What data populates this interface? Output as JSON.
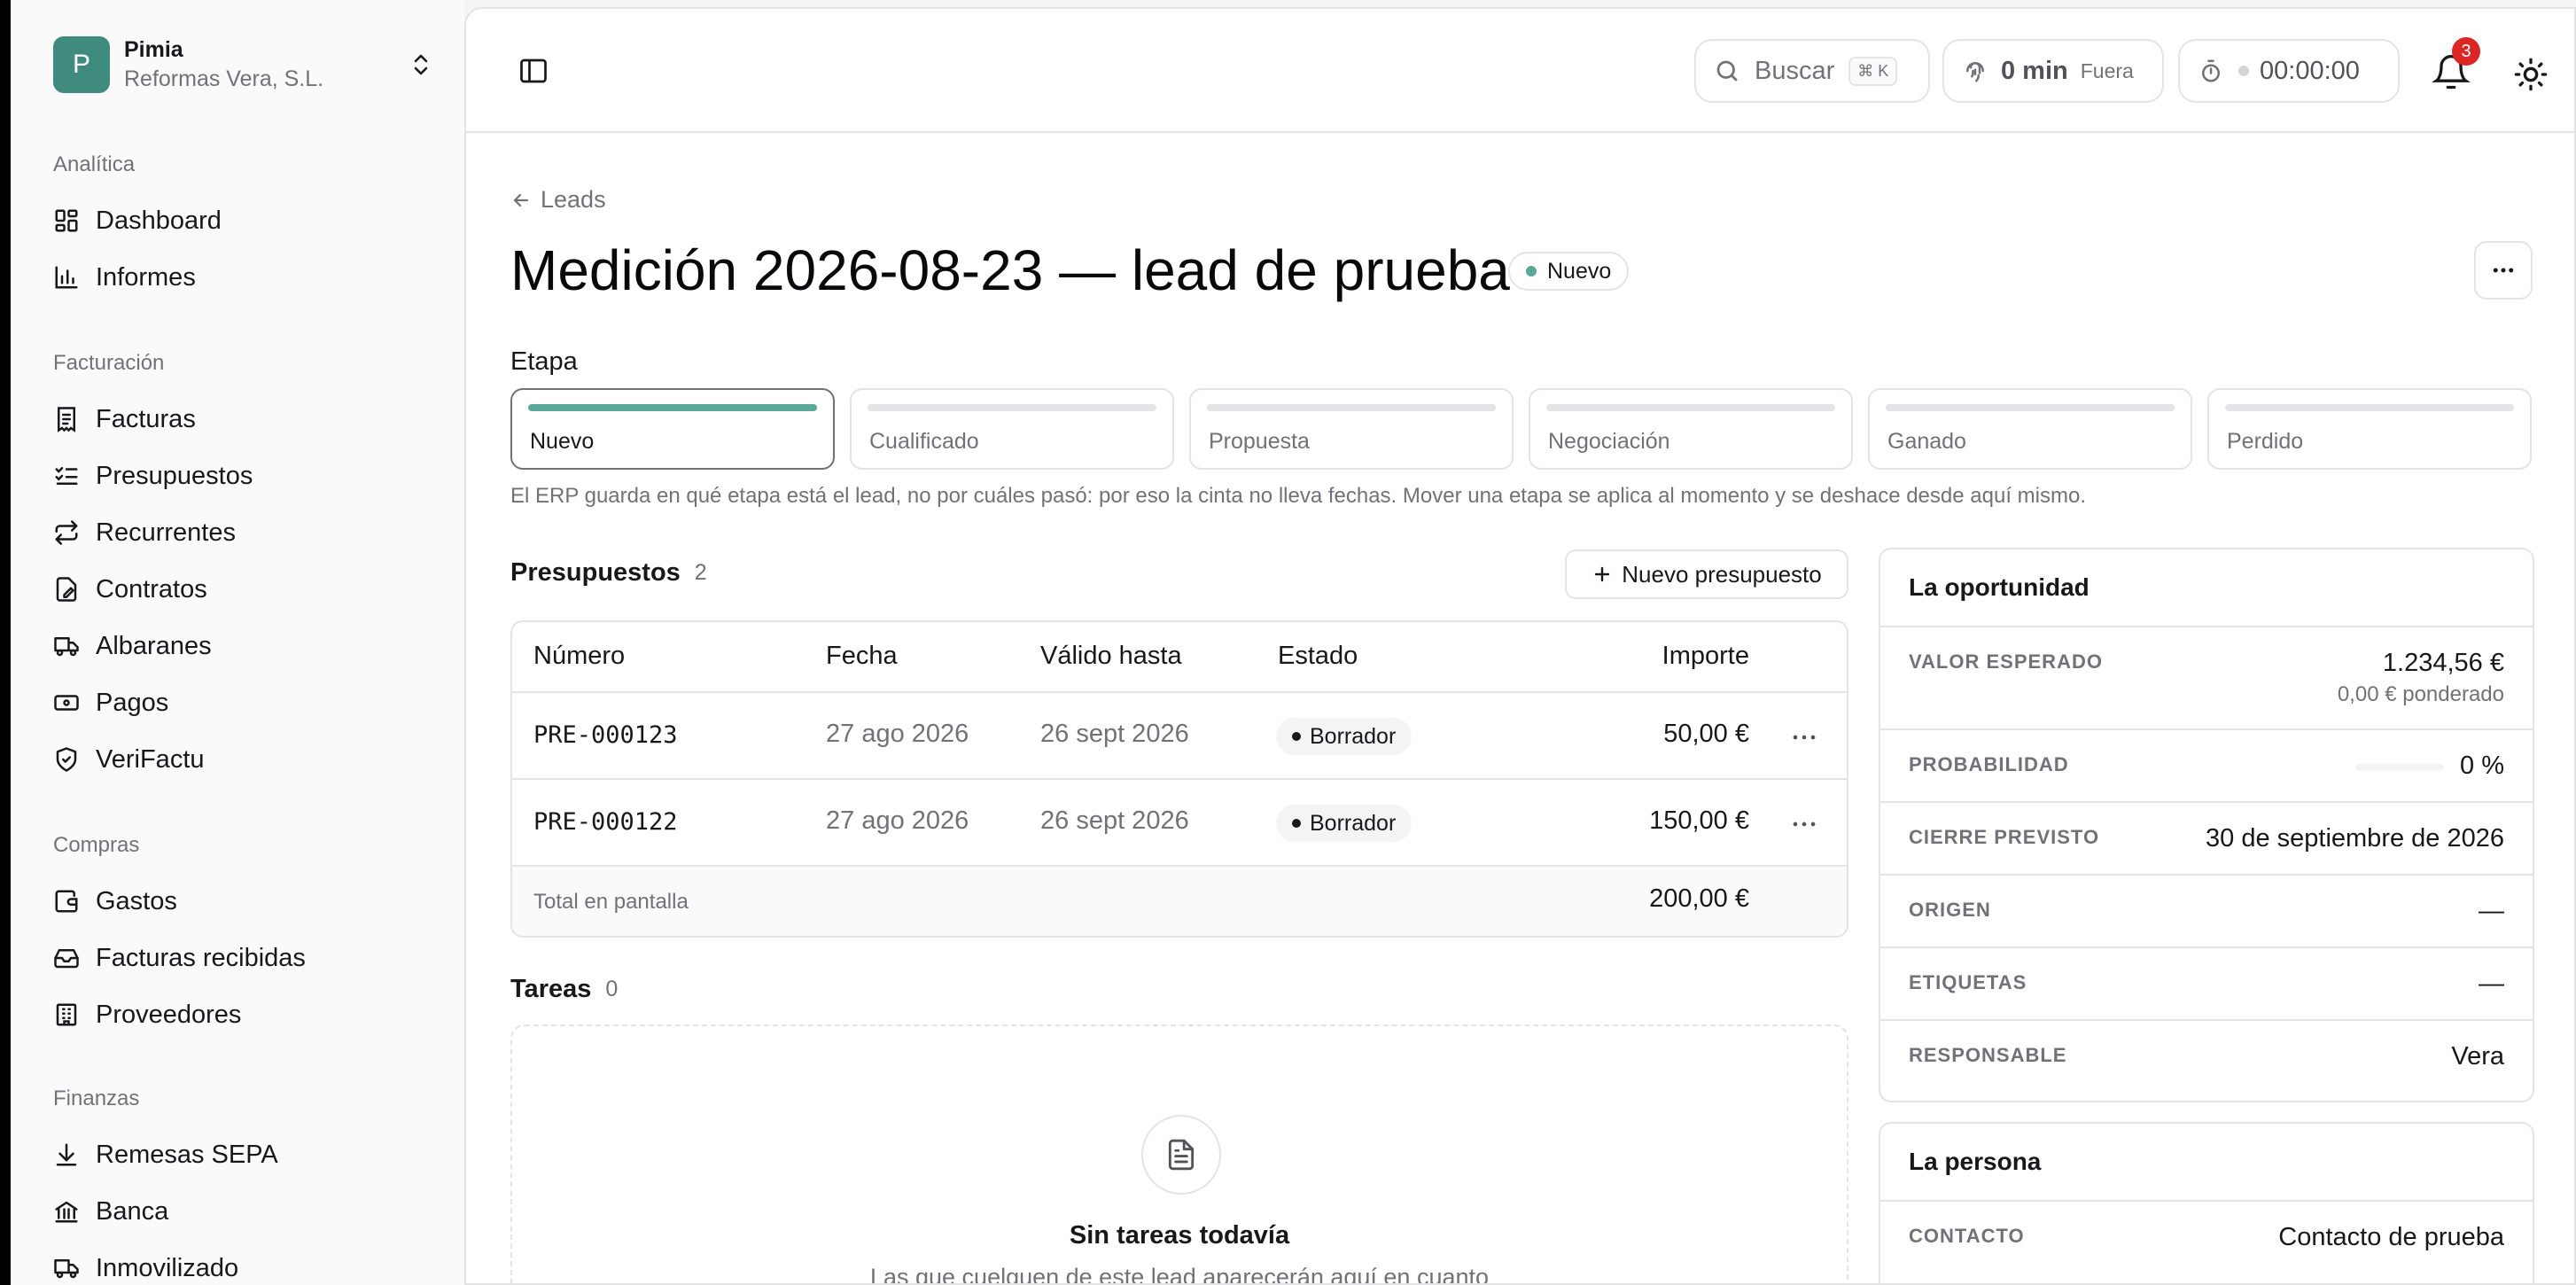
{
  "org": {
    "initial": "P",
    "name": "Pimia",
    "company": "Reformas Vera, S.L."
  },
  "sidebar": {
    "sections": [
      {
        "title": "Analítica",
        "items": [
          {
            "label": "Dashboard",
            "icon": "dashboard-icon"
          },
          {
            "label": "Informes",
            "icon": "bar-chart-icon"
          }
        ]
      },
      {
        "title": "Facturación",
        "items": [
          {
            "label": "Facturas",
            "icon": "invoice-icon"
          },
          {
            "label": "Presupuestos",
            "icon": "checklist-icon"
          },
          {
            "label": "Recurrentes",
            "icon": "repeat-icon"
          },
          {
            "label": "Contratos",
            "icon": "contract-icon"
          },
          {
            "label": "Albaranes",
            "icon": "truck-icon"
          },
          {
            "label": "Pagos",
            "icon": "cash-icon"
          },
          {
            "label": "VeriFactu",
            "icon": "shield-check-icon"
          }
        ]
      },
      {
        "title": "Compras",
        "items": [
          {
            "label": "Gastos",
            "icon": "wallet-icon"
          },
          {
            "label": "Facturas recibidas",
            "icon": "inbox-icon"
          },
          {
            "label": "Proveedores",
            "icon": "building-icon"
          }
        ]
      },
      {
        "title": "Finanzas",
        "items": [
          {
            "label": "Remesas SEPA",
            "icon": "download-icon"
          },
          {
            "label": "Banca",
            "icon": "bank-icon"
          },
          {
            "label": "Inmovilizado",
            "icon": "truck-icon"
          }
        ]
      }
    ]
  },
  "topbar": {
    "search_label": "Buscar",
    "search_shortcut": "⌘ K",
    "presence_value": "0 min",
    "presence_status": "Fuera",
    "timer": "00:00:00",
    "notifications_count": "3"
  },
  "page": {
    "breadcrumb": "Leads",
    "title": "Medición 2026-08-23 — lead de prueba",
    "status": "Nuevo",
    "stage_heading": "Etapa",
    "stages": [
      {
        "label": "Nuevo",
        "active": true
      },
      {
        "label": "Cualificado",
        "active": false
      },
      {
        "label": "Propuesta",
        "active": false
      },
      {
        "label": "Negociación",
        "active": false
      },
      {
        "label": "Ganado",
        "active": false
      },
      {
        "label": "Perdido",
        "active": false
      }
    ],
    "stage_note": "El ERP guarda en qué etapa está el lead, no por cuáles pasó: por eso la cinta no lleva fechas. Mover una etapa se aplica al momento y se deshace desde aquí mismo."
  },
  "quotes": {
    "heading": "Presupuestos",
    "count": "2",
    "new_button": "Nuevo presupuesto",
    "columns": {
      "number": "Número",
      "date": "Fecha",
      "valid": "Válido hasta",
      "status": "Estado",
      "amount": "Importe"
    },
    "rows": [
      {
        "number": "PRE-000123",
        "date": "27 ago 2026",
        "valid": "26 sept 2026",
        "status": "Borrador",
        "amount": "50,00 €"
      },
      {
        "number": "PRE-000122",
        "date": "27 ago 2026",
        "valid": "26 sept 2026",
        "status": "Borrador",
        "amount": "150,00 €"
      }
    ],
    "total_label": "Total en pantalla",
    "total_value": "200,00 €"
  },
  "tasks": {
    "heading": "Tareas",
    "count": "0",
    "empty_title": "Sin tareas todavía",
    "empty_text": "Las que cuelguen de este lead aparecerán aquí en cuanto"
  },
  "opportunity": {
    "heading": "La oportunidad",
    "expected_label": "VALOR ESPERADO",
    "expected_value": "1.234,56 €",
    "weighted": "0,00 € ponderado",
    "probability_label": "PROBABILIDAD",
    "probability_value": "0 %",
    "probability_fraction": 0,
    "close_label": "CIERRE PREVISTO",
    "close_value": "30 de septiembre de 2026",
    "origin_label": "ORIGEN",
    "origin_value": "—",
    "tags_label": "ETIQUETAS",
    "tags_value": "—",
    "owner_label": "RESPONSABLE",
    "owner_value": "Vera"
  },
  "person": {
    "heading": "La persona",
    "contact_label": "CONTACTO",
    "contact_value": "Contacto de prueba"
  },
  "colors": {
    "accent": "#3f8b7d",
    "stage_active": "#5aa898",
    "badge": "#dc2626"
  }
}
